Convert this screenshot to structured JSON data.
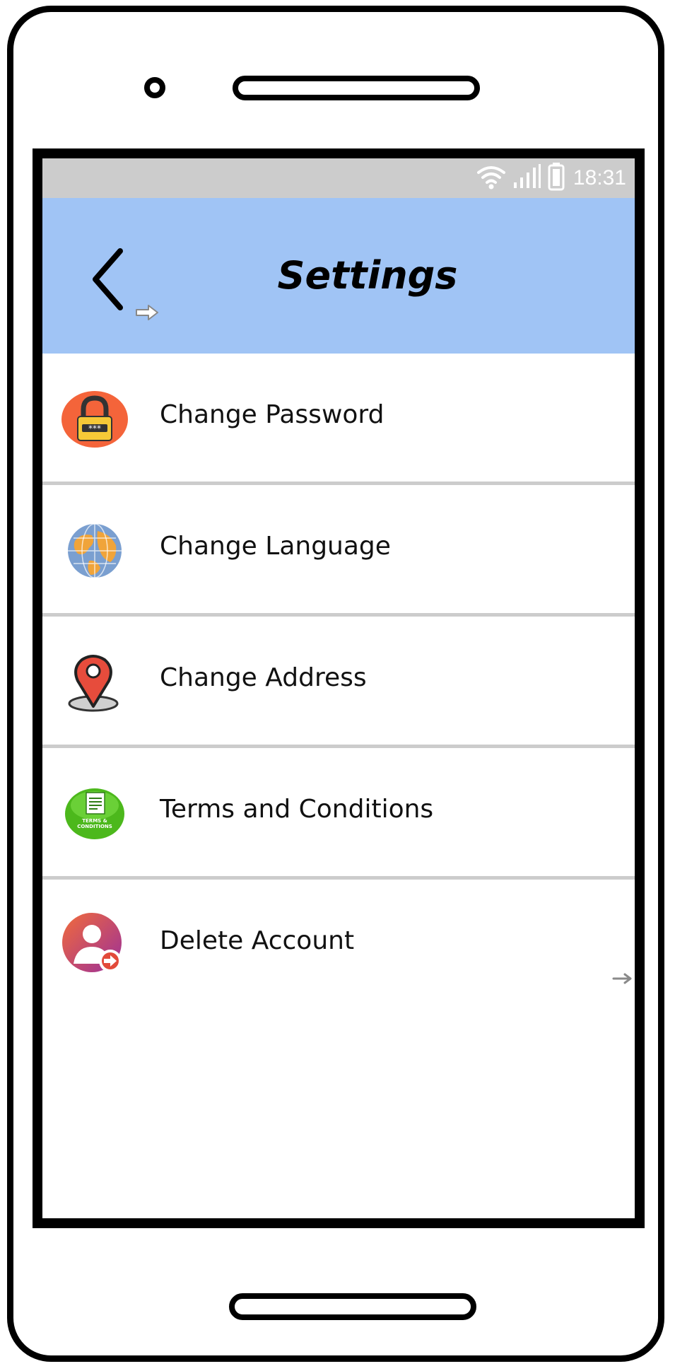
{
  "status_bar": {
    "time": "18:31",
    "icons": [
      "wifi-icon",
      "signal-icon",
      "battery-icon"
    ]
  },
  "header": {
    "title": "Settings",
    "back_icon": "chevron-left-icon"
  },
  "settings": {
    "items": [
      {
        "label": "Change Password",
        "icon": "lock-icon"
      },
      {
        "label": "Change Language",
        "icon": "globe-icon"
      },
      {
        "label": "Change Address",
        "icon": "map-pin-icon"
      },
      {
        "label": "Terms and Conditions",
        "icon": "terms-conditions-icon"
      },
      {
        "label": "Delete Account",
        "icon": "delete-account-icon"
      }
    ]
  },
  "colors": {
    "header_bg": "#a0c4f5",
    "status_bar_bg": "#cccccc",
    "divider": "#cccccc"
  }
}
